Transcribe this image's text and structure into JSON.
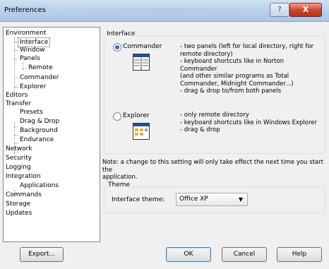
{
  "window": {
    "title": "Preferences",
    "help_glyph": "?",
    "close_glyph": "X"
  },
  "tree": {
    "items": [
      {
        "label": "Environment",
        "level": 0
      },
      {
        "label": "Interface",
        "level": 1,
        "selected": true
      },
      {
        "label": "Window",
        "level": 1
      },
      {
        "label": "Panels",
        "level": 1
      },
      {
        "label": "Remote",
        "level": 2
      },
      {
        "label": "Commander",
        "level": 1
      },
      {
        "label": "Explorer",
        "level": 1
      },
      {
        "label": "Editors",
        "level": 0
      },
      {
        "label": "Transfer",
        "level": 0
      },
      {
        "label": "Presets",
        "level": 1
      },
      {
        "label": "Drag & Drop",
        "level": 1
      },
      {
        "label": "Background",
        "level": 1
      },
      {
        "label": "Endurance",
        "level": 1
      },
      {
        "label": "Network",
        "level": 0
      },
      {
        "label": "Security",
        "level": 0
      },
      {
        "label": "Logging",
        "level": 0
      },
      {
        "label": "Integration",
        "level": 0
      },
      {
        "label": "Applications",
        "level": 1
      },
      {
        "label": "Commands",
        "level": 0
      },
      {
        "label": "Storage",
        "level": 0
      },
      {
        "label": "Updates",
        "level": 0
      }
    ]
  },
  "interface_group": {
    "title": "Interface",
    "commander": {
      "label": "Commander",
      "selected": true,
      "description": "- two panels (left for local directory, right for\nremote directory)\n- keyboard shortcuts like in Norton Commander\n(and other similar programs as Total\nCommander, Midnight Commander...)\n- drag & drop to/from both panels"
    },
    "explorer": {
      "label": "Explorer",
      "selected": false,
      "description": "- only remote directory\n- keyboard shortcuts like in Windows Explorer\n- drag & drop"
    }
  },
  "note": "Note: a change to this setting will only take effect the next time you start the\napplication.",
  "theme_group": {
    "title": "Theme",
    "field_label": "Interface theme:",
    "selected_value": "Office XP"
  },
  "buttons": {
    "export": "Export...",
    "ok": "OK",
    "cancel": "Cancel",
    "help": "Help"
  },
  "colors": {
    "titlebar": "#b9d1ec",
    "close_button": "#c7432a",
    "radio_selected": "#2d6bd0"
  },
  "icons": [
    "help-icon",
    "close-icon",
    "commander-panels-icon",
    "explorer-panel-icon",
    "dropdown-arrow-icon"
  ]
}
